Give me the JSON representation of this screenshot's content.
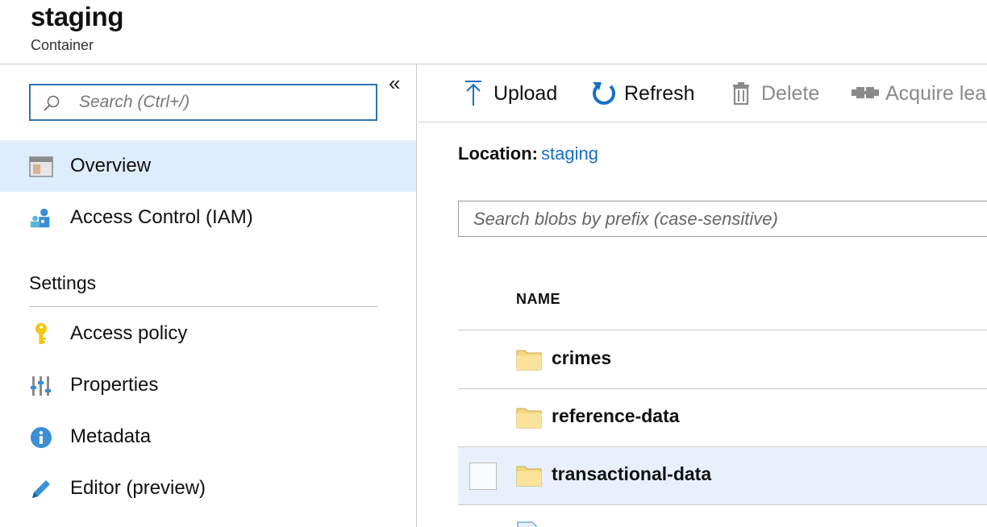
{
  "header": {
    "title": "staging",
    "subtitle": "Container"
  },
  "sidebar": {
    "search_placeholder": "Search (Ctrl+/)",
    "collapse_glyph": "«",
    "items": [
      {
        "label": "Overview",
        "icon": "overview-icon",
        "selected": true
      },
      {
        "label": "Access Control (IAM)",
        "icon": "iam-icon",
        "selected": false
      }
    ],
    "settings_section": {
      "title": "Settings",
      "items": [
        {
          "label": "Access policy",
          "icon": "key-icon"
        },
        {
          "label": "Properties",
          "icon": "properties-icon"
        },
        {
          "label": "Metadata",
          "icon": "info-icon"
        },
        {
          "label": "Editor (preview)",
          "icon": "pencil-icon"
        }
      ]
    }
  },
  "toolbar": {
    "upload_label": "Upload",
    "refresh_label": "Refresh",
    "delete_label": "Delete",
    "acquire_label": "Acquire lea"
  },
  "main": {
    "location_label": "Location:",
    "location_value": "staging",
    "blob_search_placeholder": "Search blobs by prefix (case-sensitive)",
    "column_name": "NAME",
    "rows": [
      {
        "name": "crimes",
        "type": "folder"
      },
      {
        "name": "reference-data",
        "type": "folder"
      },
      {
        "name": "transactional-data",
        "type": "folder"
      }
    ]
  },
  "colors": {
    "accent": "#2f74b5",
    "link": "#1670c8",
    "selected_bg": "#deedfb",
    "hover_row_bg": "#e8f1fb",
    "folder": "#f5d782"
  }
}
